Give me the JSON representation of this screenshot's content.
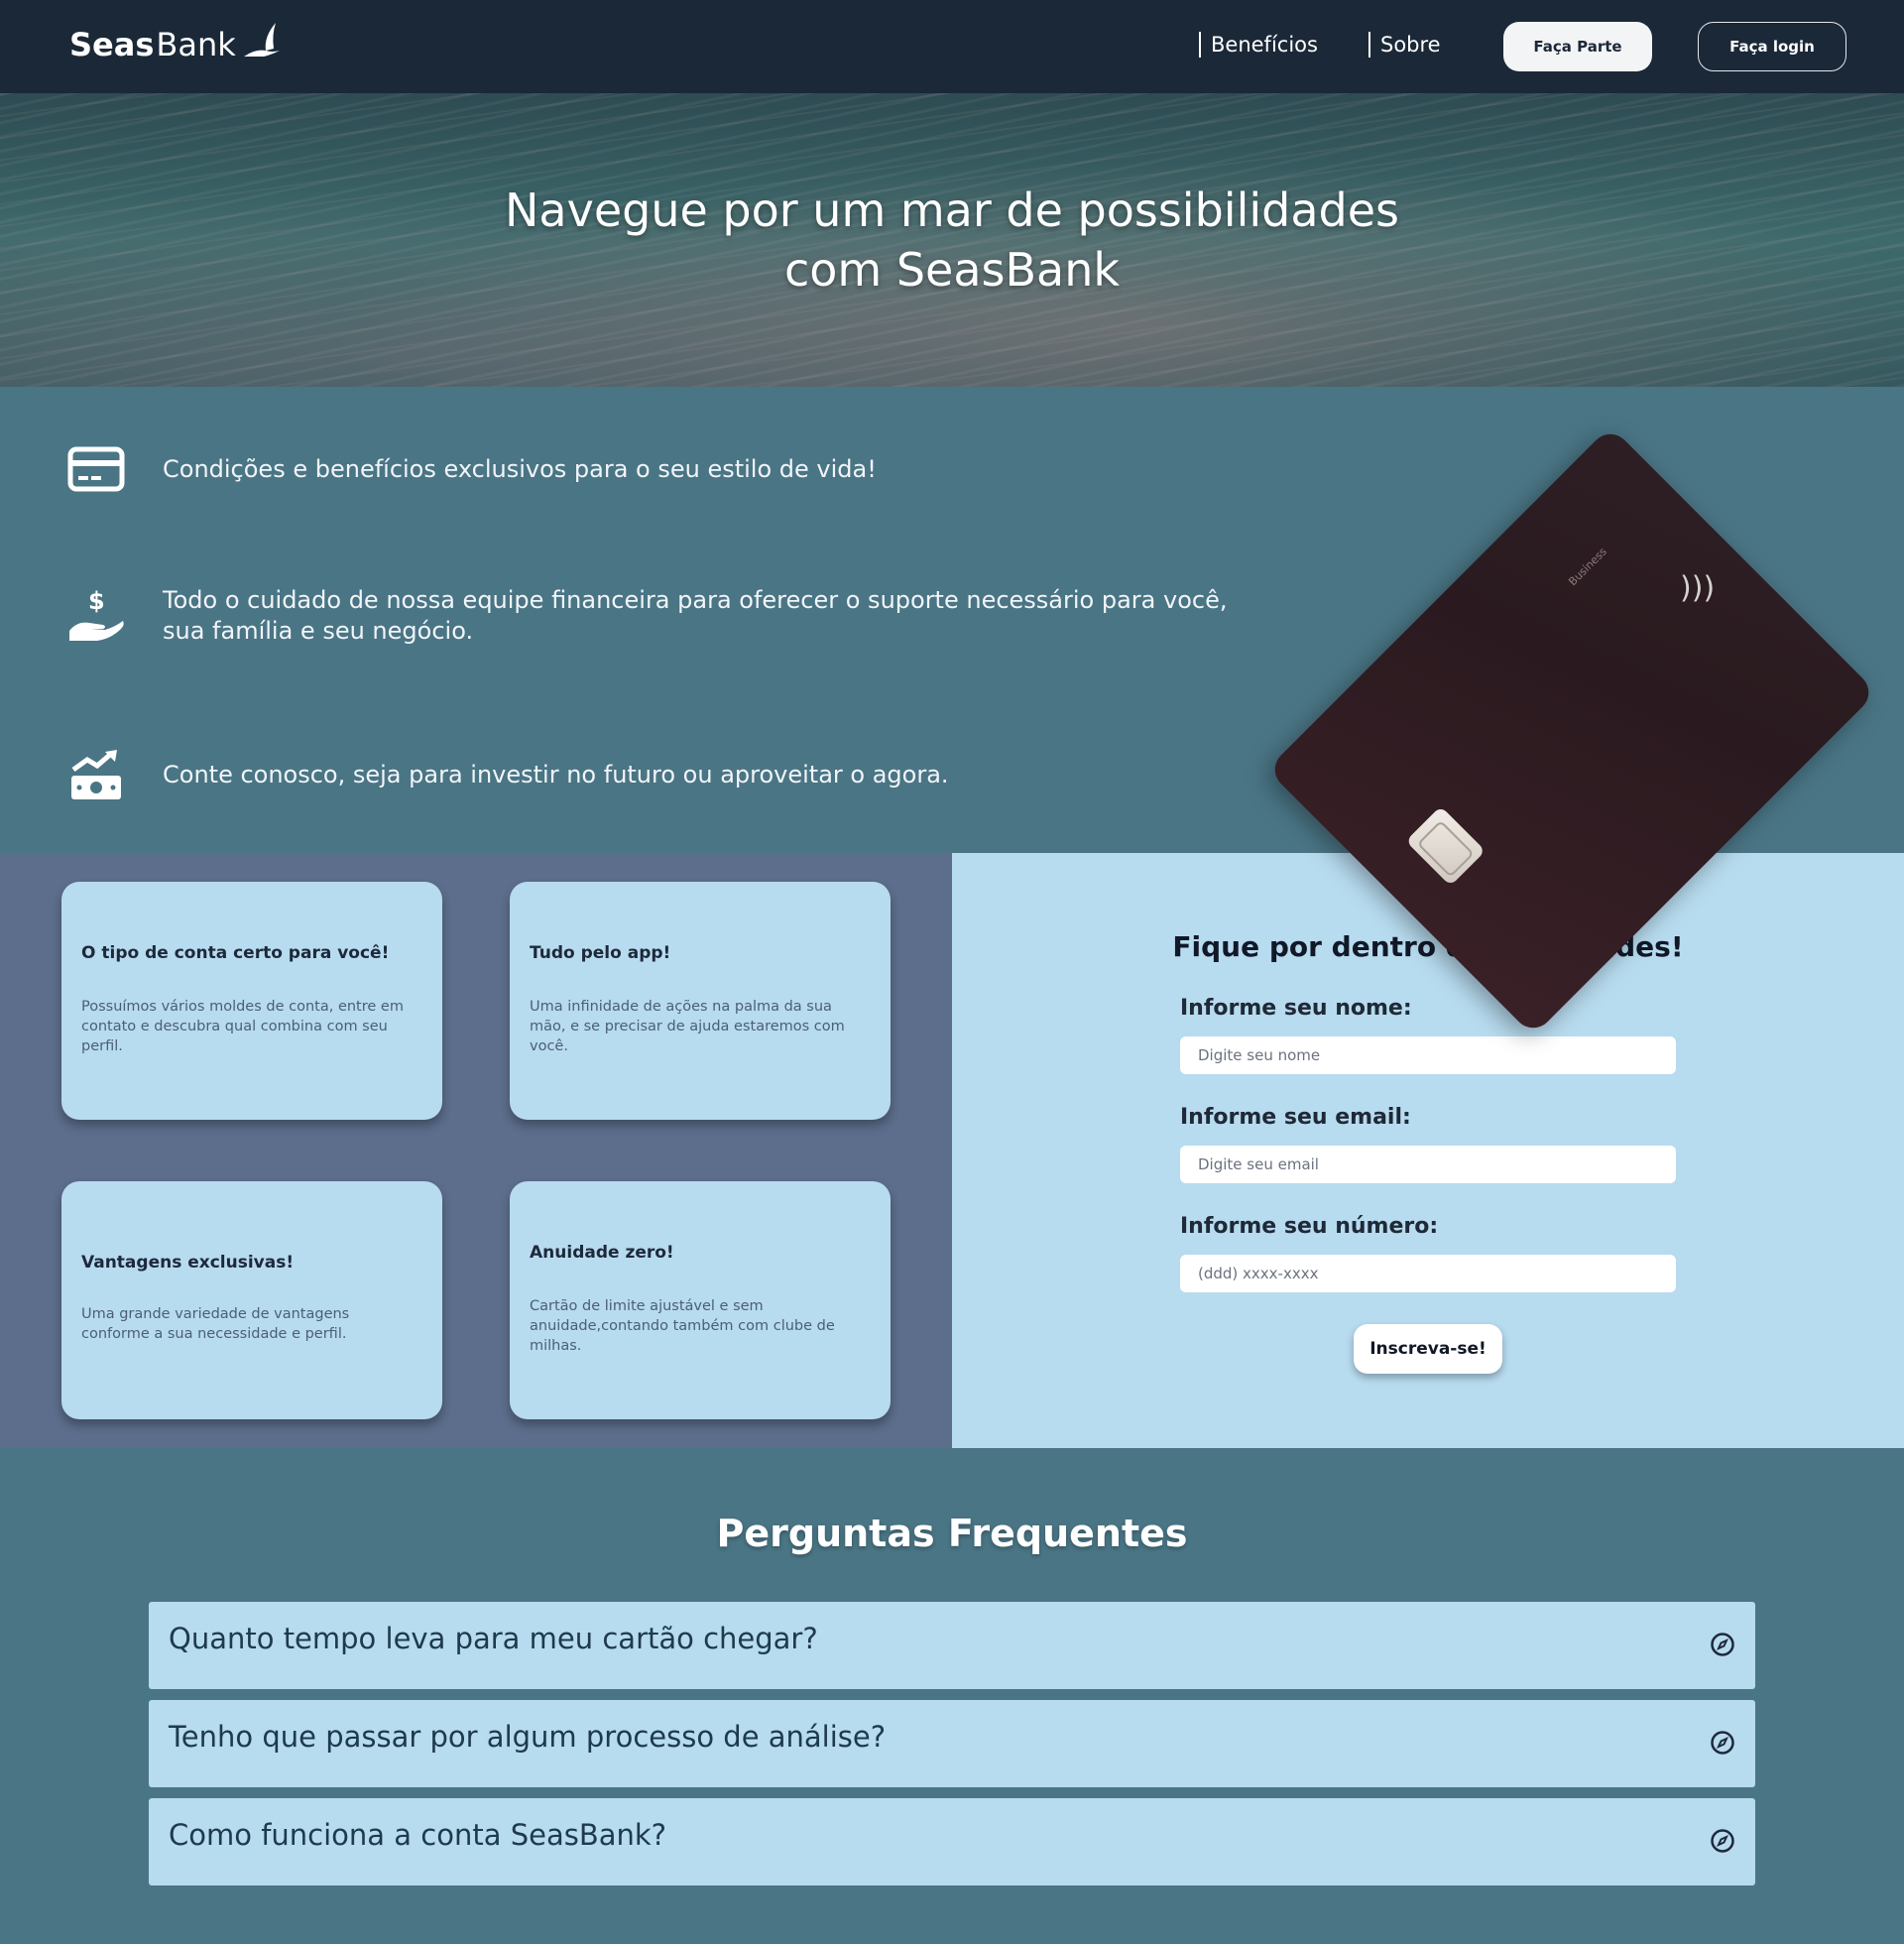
{
  "nav": {
    "logo_bold": "Seas",
    "logo_light": "Bank",
    "links": [
      "Benefícios",
      "Sobre"
    ],
    "join_label": "Faça Parte",
    "login_label": "Faça login"
  },
  "hero": {
    "title_line1": "Navegue por um mar de possibilidades",
    "title_line2": "com SeasBank"
  },
  "features": [
    {
      "icon": "credit-card-icon",
      "text": "Condições e benefícios exclusivos para o seu estilo de vida!"
    },
    {
      "icon": "hand-dollar-icon",
      "text": "Todo o cuidado de nossa equipe financeira para oferecer o suporte necessário para você, sua família e seu negócio."
    },
    {
      "icon": "money-growth-icon",
      "text": "Conte conosco, seja para investir no futuro ou aproveitar o agora."
    }
  ],
  "card_image": {
    "label": "Business"
  },
  "info_cards": [
    {
      "title": "O tipo de conta certo para você!",
      "desc": "Possuímos vários moldes de conta, entre em contato e descubra qual combina com seu perfil."
    },
    {
      "title": "Tudo pelo app!",
      "desc": "Uma infinidade de ações na palma da sua mão, e se precisar de ajuda estaremos com você."
    },
    {
      "title": "Vantagens exclusivas!",
      "desc": "Uma grande variedade de vantagens conforme a sua necessidade e perfil."
    },
    {
      "title": "Anuidade zero!",
      "desc": "Cartão de limite ajustável e sem anuidade,contando também com clube de milhas."
    }
  ],
  "newsletter": {
    "title": "Fique por dentro das novidades!",
    "name_label": "Informe seu nome:",
    "name_placeholder": "Digite seu nome",
    "email_label": "Informe seu email:",
    "email_placeholder": "Digite seu email",
    "phone_label": "Informe seu número:",
    "phone_placeholder": "(ddd) xxxx-xxxx",
    "submit_label": "Inscreva-se!"
  },
  "faq": {
    "title": "Perguntas Frequentes",
    "items": [
      {
        "question": "Quanto tempo leva para meu cartão chegar?",
        "icon": "compass-icon"
      },
      {
        "question": "Tenho que passar por algum processo de análise?",
        "icon": "compass-icon"
      },
      {
        "question": "Como funciona a conta SeasBank?",
        "icon": "compass-icon"
      }
    ]
  }
}
